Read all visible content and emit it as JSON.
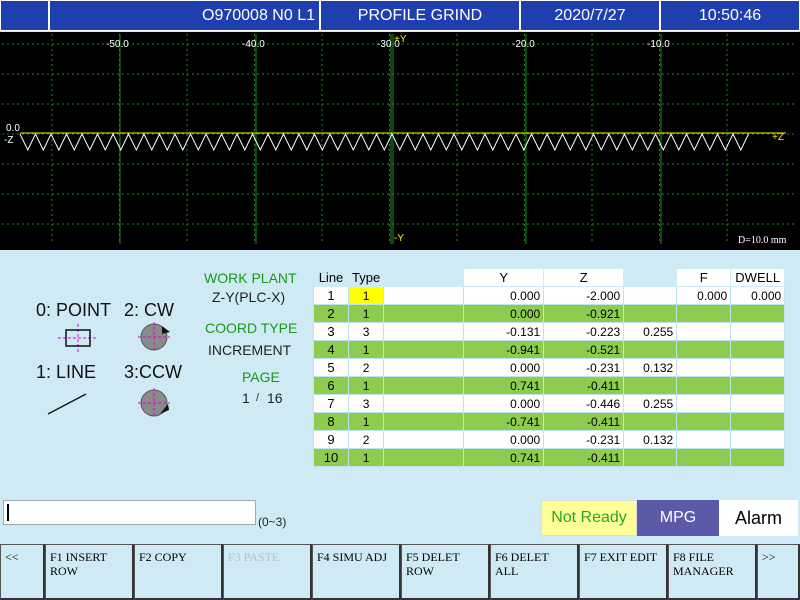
{
  "header": {
    "program": "O970008 N0 L1",
    "mode": "PROFILE GRIND",
    "date": "2020/7/27",
    "time": "10:50:46"
  },
  "graph": {
    "x_ticks": [
      "-50.0",
      "-40.0",
      "-30.0",
      "-20.0",
      "-10.0"
    ],
    "y_zero": "0.0",
    "axis_plus_y": "+Y",
    "axis_minus_y": "-Y",
    "axis_plus_z": "+Z",
    "axis_minus_z": "-Z",
    "scale_label": "D=10.0 mm",
    "colors": {
      "grid": "#1e8a1e",
      "axis": "#ffee00",
      "profile": "#ffffff",
      "background": "#000000"
    }
  },
  "legend": {
    "point": "0: POINT",
    "cw": "2: CW",
    "line": "1: LINE",
    "ccw": "3:CCW"
  },
  "info": {
    "work_plane_label": "WORK PLANT",
    "work_plane_value": "Z-Y(PLC-X)",
    "coord_type_label": "COORD TYPE",
    "coord_type_value": "INCREMENT",
    "page_label": "PAGE",
    "page_current": "1",
    "page_sep": "/",
    "page_total": "16"
  },
  "table": {
    "headers": {
      "line": "Line",
      "type": "Type",
      "y": "Y",
      "z": "Z",
      "f": "F",
      "dwell": "DWELL"
    },
    "rows": [
      {
        "line": "1",
        "type": "1",
        "y": "0.000",
        "z": "-2.000",
        "r": "",
        "f": "0.000",
        "dwell": "0.000"
      },
      {
        "line": "2",
        "type": "1",
        "y": "0.000",
        "z": "-0.921",
        "r": "",
        "f": "",
        "dwell": ""
      },
      {
        "line": "3",
        "type": "3",
        "y": "-0.131",
        "z": "-0.223",
        "r": "0.255",
        "f": "",
        "dwell": ""
      },
      {
        "line": "4",
        "type": "1",
        "y": "-0.941",
        "z": "-0.521",
        "r": "",
        "f": "",
        "dwell": ""
      },
      {
        "line": "5",
        "type": "2",
        "y": "0.000",
        "z": "-0.231",
        "r": "0.132",
        "f": "",
        "dwell": ""
      },
      {
        "line": "6",
        "type": "1",
        "y": "0.741",
        "z": "-0.411",
        "r": "",
        "f": "",
        "dwell": ""
      },
      {
        "line": "7",
        "type": "3",
        "y": "0.000",
        "z": "-0.446",
        "r": "0.255",
        "f": "",
        "dwell": ""
      },
      {
        "line": "8",
        "type": "1",
        "y": "-0.741",
        "z": "-0.411",
        "r": "",
        "f": "",
        "dwell": ""
      },
      {
        "line": "9",
        "type": "2",
        "y": "0.000",
        "z": "-0.231",
        "r": "0.132",
        "f": "",
        "dwell": ""
      },
      {
        "line": "10",
        "type": "1",
        "y": "0.741",
        "z": "-0.411",
        "r": "",
        "f": "",
        "dwell": ""
      }
    ]
  },
  "command": {
    "input_value": "",
    "range_hint": "(0~3)"
  },
  "status": {
    "ready": "Not Ready",
    "mpg": "MPG",
    "alarm": "Alarm",
    "colors": {
      "ready_bg": "#ffff99",
      "ready_fg": "#2aa52a",
      "mpg_bg": "#5a5aa8",
      "alarm_bg": "#ffffff"
    }
  },
  "softkeys": {
    "prev": "<<",
    "f1a": "F1 INSERT",
    "f1b": "ROW",
    "f2": "F2 COPY",
    "f3": "F3 PASTE",
    "f4": "F4 SIMU ADJ",
    "f5a": "F5 DELET",
    "f5b": "ROW",
    "f6": "F6 DELET ALL",
    "f7": "F7 EXIT EDIT",
    "f8a": "F8 FILE",
    "f8b": "MANAGER",
    "next": ">>"
  }
}
